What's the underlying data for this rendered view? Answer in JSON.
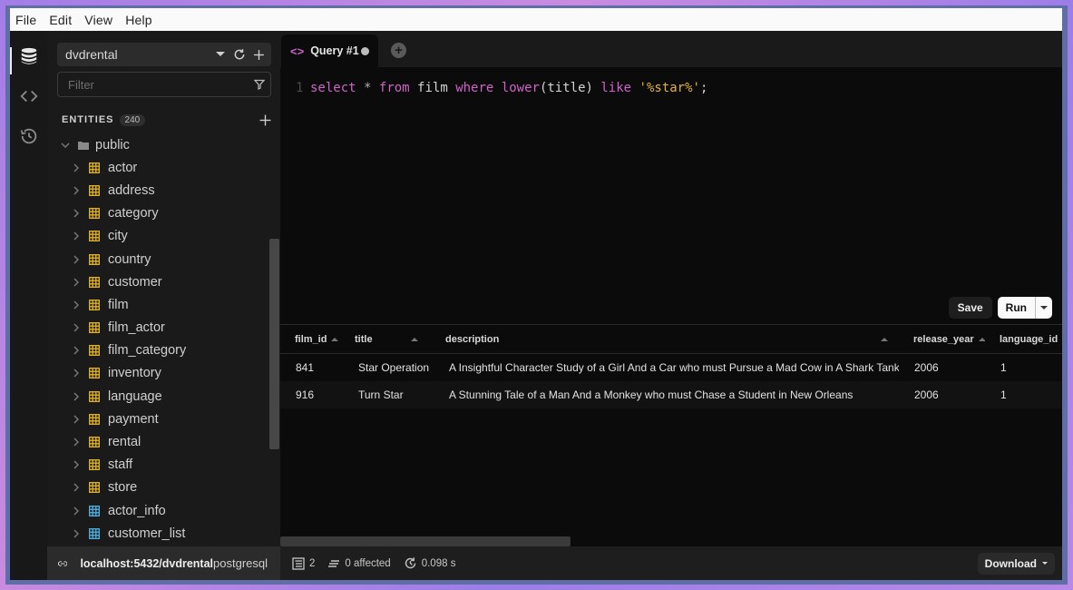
{
  "menubar": {
    "items": [
      "File",
      "Edit",
      "View",
      "Help"
    ]
  },
  "activity": {
    "items": [
      {
        "icon": "database-icon",
        "active": true
      },
      {
        "icon": "code-icon",
        "active": false
      },
      {
        "icon": "history-icon",
        "active": false
      }
    ]
  },
  "sidebar": {
    "database": "dvdrental",
    "filter_placeholder": "Filter",
    "entities_label": "ENTITIES",
    "entities_count": "240",
    "schema": "public",
    "tables": [
      {
        "name": "actor",
        "kind": "table"
      },
      {
        "name": "address",
        "kind": "table"
      },
      {
        "name": "category",
        "kind": "table"
      },
      {
        "name": "city",
        "kind": "table"
      },
      {
        "name": "country",
        "kind": "table"
      },
      {
        "name": "customer",
        "kind": "table"
      },
      {
        "name": "film",
        "kind": "table"
      },
      {
        "name": "film_actor",
        "kind": "table"
      },
      {
        "name": "film_category",
        "kind": "table"
      },
      {
        "name": "inventory",
        "kind": "table"
      },
      {
        "name": "language",
        "kind": "table"
      },
      {
        "name": "payment",
        "kind": "table"
      },
      {
        "name": "rental",
        "kind": "table"
      },
      {
        "name": "staff",
        "kind": "table"
      },
      {
        "name": "store",
        "kind": "table"
      },
      {
        "name": "actor_info",
        "kind": "view"
      },
      {
        "name": "customer_list",
        "kind": "view"
      }
    ],
    "connection": "localhost:5432/dvdrental",
    "dialect": "postgresql"
  },
  "colors": {
    "table_icon": "#e8b820",
    "view_icon": "#4fb6e8",
    "keyword": "#d062c9",
    "string": "#e0b43a"
  },
  "tabs": [
    {
      "label": "Query #1",
      "unsaved": true
    }
  ],
  "editor": {
    "line_number": "1",
    "tokens": [
      {
        "t": "select",
        "c": "kw"
      },
      {
        "t": " ",
        "c": "id"
      },
      {
        "t": "*",
        "c": "op"
      },
      {
        "t": " ",
        "c": "id"
      },
      {
        "t": "from",
        "c": "kw"
      },
      {
        "t": " film ",
        "c": "id"
      },
      {
        "t": "where",
        "c": "kw"
      },
      {
        "t": " ",
        "c": "id"
      },
      {
        "t": "lower",
        "c": "fn"
      },
      {
        "t": "(title) ",
        "c": "id"
      },
      {
        "t": "like",
        "c": "kw"
      },
      {
        "t": " ",
        "c": "id"
      },
      {
        "t": "'%star%'",
        "c": "str"
      },
      {
        "t": ";",
        "c": "id"
      }
    ]
  },
  "actions": {
    "save": "Save",
    "run": "Run"
  },
  "results": {
    "columns": [
      "film_id",
      "title",
      "description",
      "release_year",
      "language_id"
    ],
    "rows": [
      [
        "841",
        "Star Operation",
        "A Insightful Character Study of a Girl And a Car who must Pursue a Mad Cow in A Shark Tank",
        "2006",
        "1"
      ],
      [
        "916",
        "Turn Star",
        "A Stunning Tale of a Man And a Monkey who must Chase a Student in New Orleans",
        "2006",
        "1"
      ]
    ]
  },
  "status": {
    "rows": "2",
    "affected": "0 affected",
    "duration": "0.098 s",
    "download": "Download"
  }
}
